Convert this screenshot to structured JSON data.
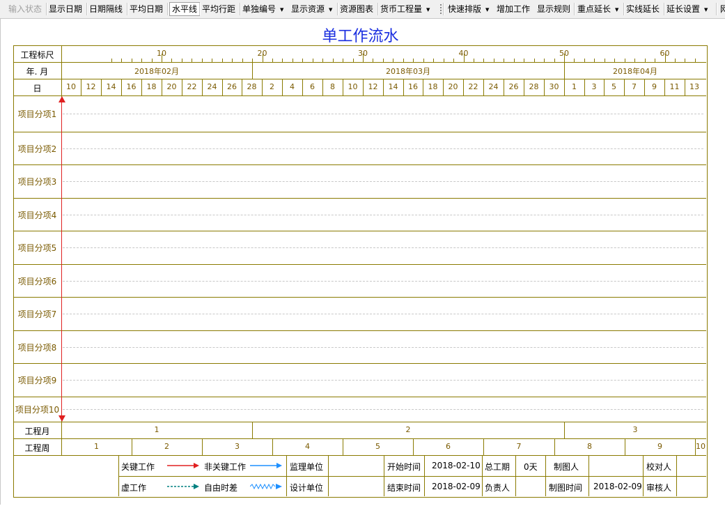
{
  "toolbar": {
    "buttons": [
      {
        "label": "输入状态",
        "disabled": true
      },
      {
        "label": "显示日期"
      },
      {
        "label": "日期隔线"
      },
      {
        "label": "平均日期"
      },
      {
        "label": "水平线",
        "pressed": true
      },
      {
        "label": "平均行距"
      },
      {
        "label": "单独编号",
        "dropdown": true
      },
      {
        "label": "显示资源",
        "dropdown": true
      },
      {
        "label": "资源图表"
      },
      {
        "label": "货币工程量",
        "dropdown": true
      },
      {
        "label": "快速排版",
        "dropdown": true
      },
      {
        "label": "增加工作"
      },
      {
        "label": "显示规则"
      },
      {
        "label": "重点延长",
        "dropdown": true
      },
      {
        "label": "实线延长"
      },
      {
        "label": "延长设置",
        "dropdown": true
      },
      {
        "label": "网"
      }
    ]
  },
  "chart": {
    "title": "单工作流水",
    "row_labels": {
      "scale": "工程标尺",
      "month": "年. 月",
      "day": "日",
      "project_month": "工程月",
      "project_week": "工程周"
    },
    "scale_ticks": [
      "10",
      "20",
      "30",
      "40",
      "50",
      "60"
    ],
    "months": [
      "2018年02月",
      "2018年03月",
      "2018年04月"
    ],
    "days": [
      "10",
      "12",
      "14",
      "16",
      "18",
      "20",
      "22",
      "24",
      "26",
      "28",
      "2",
      "4",
      "6",
      "8",
      "10",
      "12",
      "14",
      "16",
      "18",
      "20",
      "22",
      "24",
      "26",
      "28",
      "30",
      "1",
      "3",
      "5",
      "7",
      "9",
      "11",
      "13"
    ],
    "tasks": [
      "项目分项1",
      "项目分项2",
      "项目分项3",
      "项目分项4",
      "项目分项5",
      "项目分项6",
      "项目分项7",
      "项目分项8",
      "项目分项9",
      "项目分项10"
    ],
    "project_months": [
      "1",
      "2",
      "3"
    ],
    "project_weeks": [
      "1",
      "2",
      "3",
      "4",
      "5",
      "6",
      "7",
      "8",
      "9",
      "10"
    ]
  },
  "legend": {
    "critical": "关键工作",
    "non_critical": "非关键工作",
    "dummy": "虚工作",
    "free_float": "自由时差",
    "critical_color": "#e02020",
    "non_critical_color": "#1e90ff",
    "dummy_color": "#008080"
  },
  "info": {
    "supervisor_label": "监理单位",
    "designer_label": "设计单位",
    "start_label": "开始时间",
    "start_value": "2018-02-10",
    "end_label": "结束时间",
    "end_value": "2018-02-09",
    "duration_label": "总工期",
    "duration_value": "0天",
    "owner_label": "负责人",
    "drafter_label": "制图人",
    "draft_time_label": "制图时间",
    "draft_time_value": "2018-02-09",
    "checker_label": "校对人",
    "reviewer_label": "审核人"
  }
}
